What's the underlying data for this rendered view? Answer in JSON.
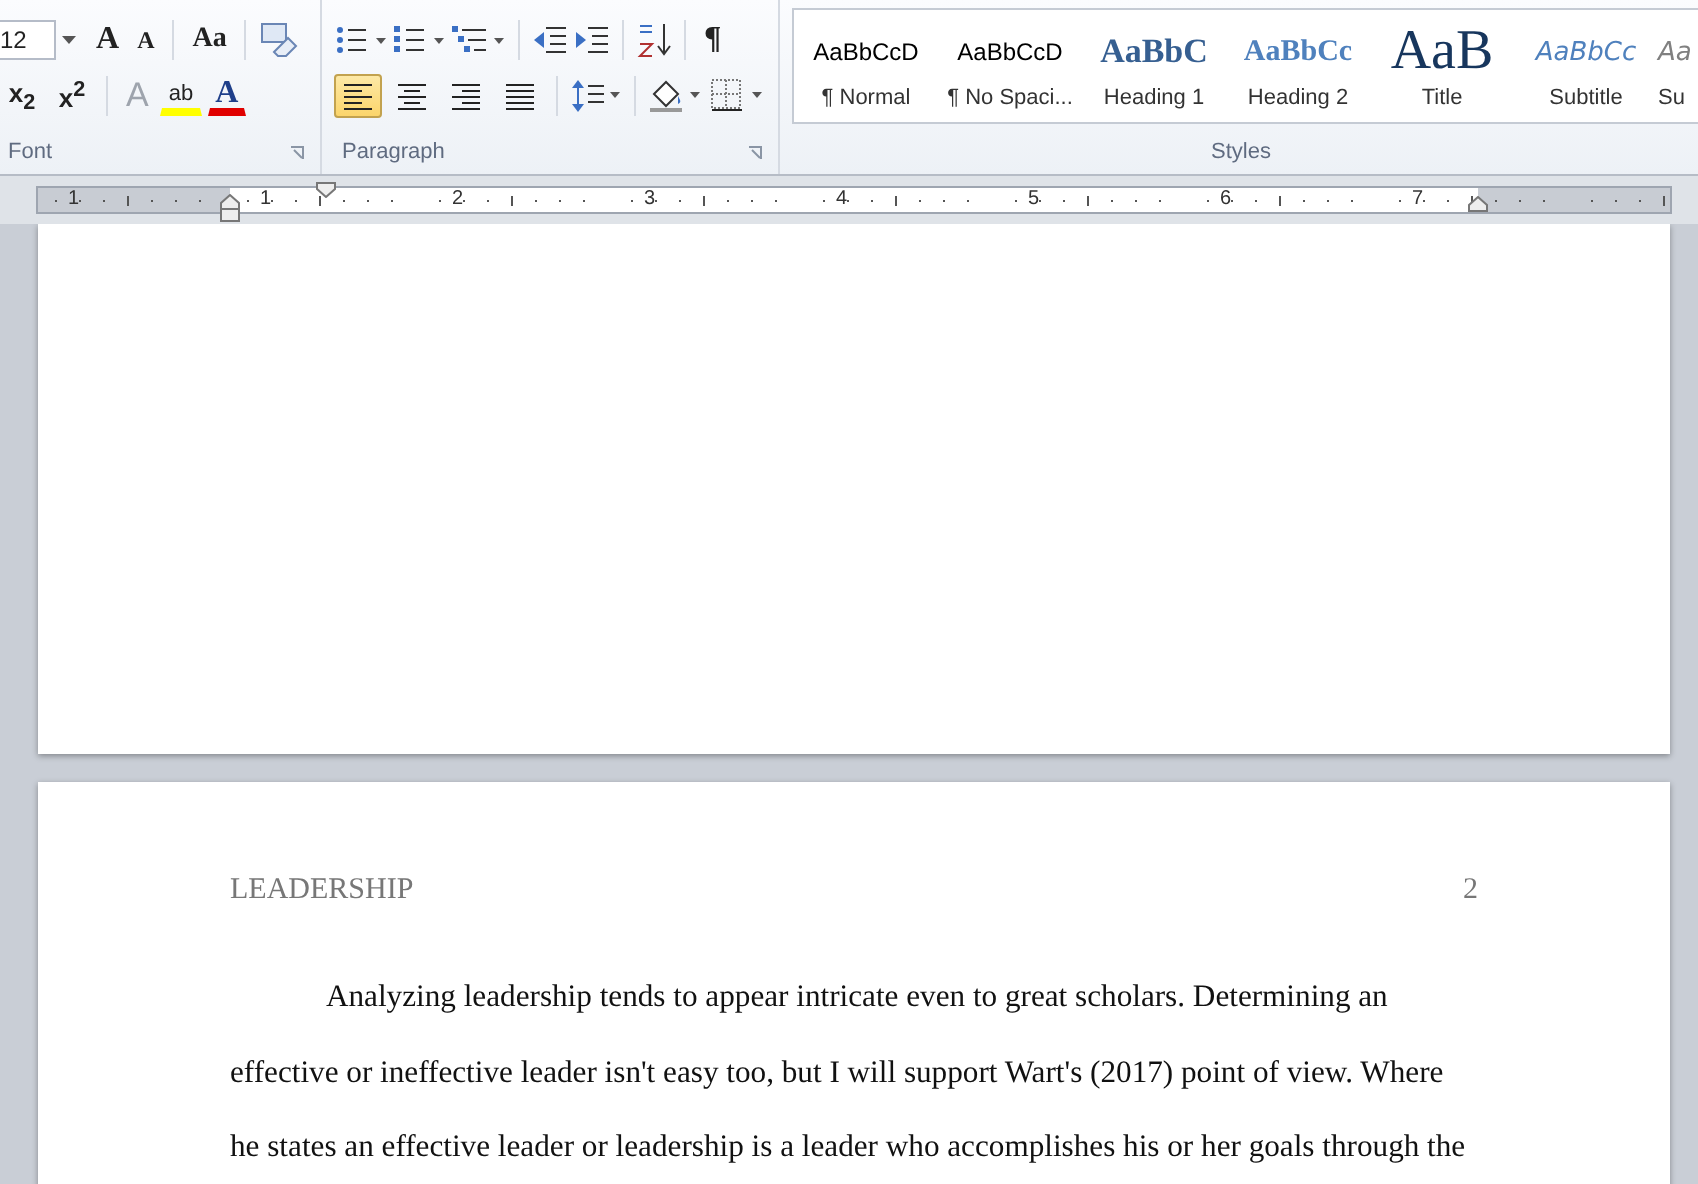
{
  "ribbon": {
    "font_group": {
      "label": "Font",
      "size_field": {
        "value": "12"
      },
      "grow_glyph": "A",
      "shrink_glyph": "A",
      "case_glyph": "Aa",
      "subscript": "x$_{2}$",
      "superscript": "x$^{2}$",
      "effects_glyph": "A",
      "highlight_glyph": "ab",
      "font_color_glyph": "A"
    },
    "paragraph_group": {
      "label": "Paragraph",
      "pilcrow": "¶",
      "alignment": [
        {
          "kind": "left",
          "selected": true
        },
        {
          "kind": "center",
          "selected": false
        },
        {
          "kind": "right",
          "selected": false
        },
        {
          "kind": "justify",
          "selected": false
        }
      ]
    },
    "styles_group": {
      "label": "Styles",
      "styles": [
        {
          "kind": "normal",
          "preview": "AaBbCcD",
          "name": "¶ Normal"
        },
        {
          "kind": "normal",
          "preview": "AaBbCcD",
          "name": "¶ No Spaci..."
        },
        {
          "kind": "heading1",
          "preview": "AaBbC",
          "name": "Heading 1"
        },
        {
          "kind": "heading2",
          "preview": "AaBbCc",
          "name": "Heading 2"
        },
        {
          "kind": "title",
          "preview": "AaB",
          "name": "Title"
        },
        {
          "kind": "subtitle",
          "preview": "AaBbCc",
          "name": "Subtitle"
        },
        {
          "kind": "subtle",
          "preview": "Aa",
          "name": "Su"
        }
      ]
    }
  },
  "ruler": {
    "labels": [
      "1",
      "1",
      "2",
      "3",
      "4",
      "5",
      "6",
      "7"
    ]
  },
  "document": {
    "header": {
      "running_head": "LEADERSHIP",
      "page_number": "2"
    },
    "paragraph": "Analyzing leadership tends to appear intricate even to great scholars. Determining an effective or ineffective leader isn't easy too, but I will support Wart's (2017) point of view. Where he states an effective leader or leadership is a leader who accomplishes his or her goals through the"
  }
}
